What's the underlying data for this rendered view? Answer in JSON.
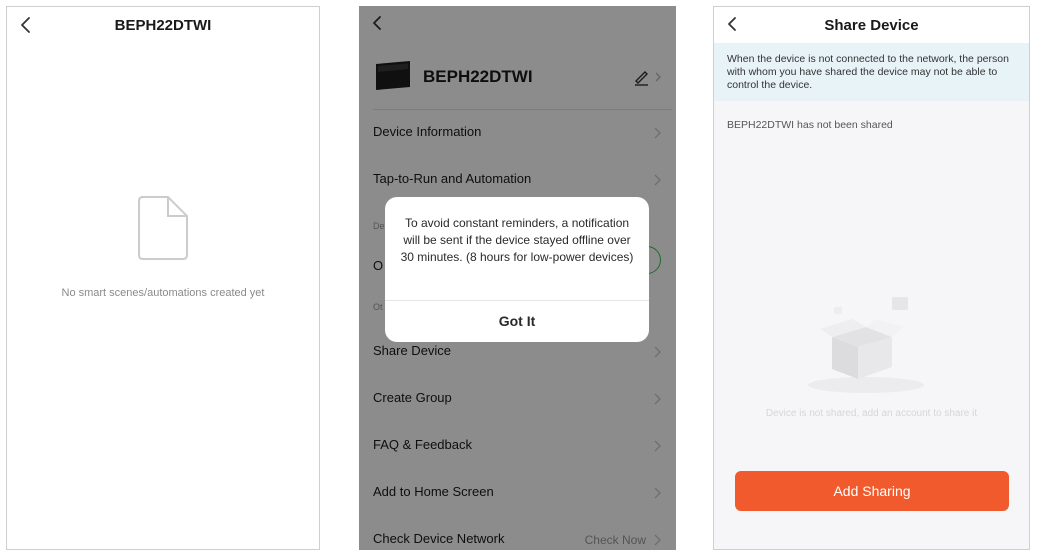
{
  "panel1": {
    "title": "BEPH22DTWI",
    "back_icon": "chevron-left-icon",
    "empty_icon": "document-icon",
    "empty_text": "No smart scenes/automations created yet"
  },
  "panel2": {
    "device_name": "BEPH22DTWI",
    "menu": {
      "device_info": "Device Information",
      "tap_to_run": "Tap-to-Run and Automation",
      "section1_fragment": "De",
      "offline_fragment": "O",
      "section2_fragment": "Ot",
      "share_device": "Share Device",
      "create_group": "Create Group",
      "faq": "FAQ & Feedback",
      "add_home": "Add to Home Screen",
      "check_network": "Check Device Network",
      "check_now": "Check Now"
    },
    "dialog": {
      "message": "To avoid constant reminders, a notification will be sent if the device stayed offline over 30 minutes. (8 hours for low-power devices)",
      "button": "Got It"
    }
  },
  "panel3": {
    "title": "Share Device",
    "notice": "When the device is not connected to the network, the person with whom you have shared the device may not be able to control the device.",
    "status": "BEPH22DTWI has not been shared",
    "hint": "Device is not shared, add an account to share it",
    "add_button": "Add Sharing",
    "accent_color": "#f15a2c"
  }
}
